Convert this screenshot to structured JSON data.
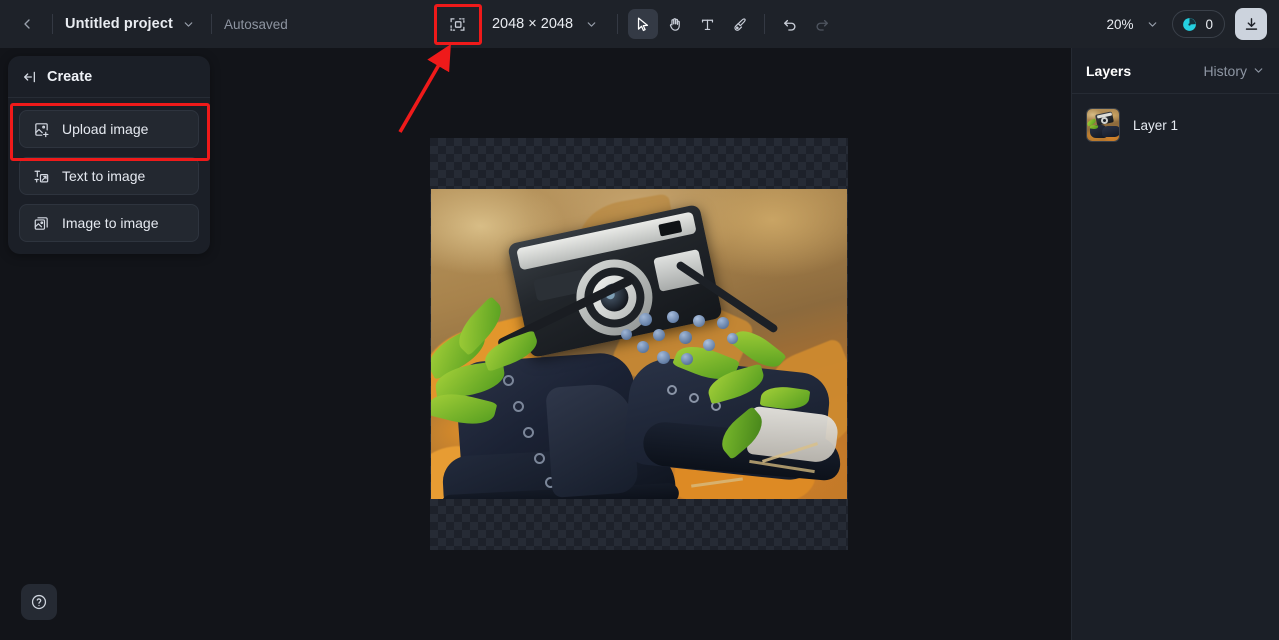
{
  "app": {
    "background_color": "#121419",
    "topbar_color": "#1e2229",
    "panel_color": "#1b1f27",
    "accent_color": "#ef1a1a",
    "credit_icon_color": "#25d0e0"
  },
  "topbar": {
    "back_label": "Back",
    "project_title": "Untitled project",
    "project_menu_icon": "chevron-down-icon",
    "autosave_status": "Autosaved",
    "resize_tool_icon": "crop-resize-icon",
    "canvas_size": "2048 × 2048",
    "canvas_size_menu_icon": "chevron-down-icon",
    "tools": [
      {
        "name": "select-tool",
        "icon": "cursor-arrow-icon",
        "active": true,
        "disabled": false
      },
      {
        "name": "hand-tool",
        "icon": "hand-icon",
        "active": false,
        "disabled": false
      },
      {
        "name": "text-tool",
        "icon": "text-t-icon",
        "active": false,
        "disabled": false
      },
      {
        "name": "brush-tool",
        "icon": "paintbrush-icon",
        "active": false,
        "disabled": false
      },
      {
        "name": "undo-button",
        "icon": "undo-arrow-icon",
        "active": false,
        "disabled": false
      },
      {
        "name": "redo-button",
        "icon": "redo-arrow-icon",
        "active": false,
        "disabled": true
      }
    ],
    "zoom_level": "20%",
    "zoom_menu_icon": "chevron-down-icon",
    "credits_count": "0",
    "credits_icon": "credit-coin-icon",
    "download_icon": "download-icon"
  },
  "create_panel": {
    "collapse_icon": "collapse-left-icon",
    "title": "Create",
    "items": [
      {
        "label": "Upload image",
        "icon": "image-plus-icon",
        "highlighted": true
      },
      {
        "label": "Text to image",
        "icon": "text-to-image-icon",
        "highlighted": false
      },
      {
        "label": "Image to image",
        "icon": "image-stack-icon",
        "highlighted": false
      }
    ]
  },
  "layers_panel": {
    "tab_layers": "Layers",
    "tab_history": "History",
    "history_chevron_icon": "chevron-down-icon",
    "layers": [
      {
        "name": "Layer 1",
        "thumbnail": "boots-camera-autumn-leaves"
      }
    ]
  },
  "canvas": {
    "artboard_label": "2048 × 2048 artboard",
    "transparency_pattern": "checkerboard",
    "image_description": "Vintage film camera resting on dark navy leather boots among autumn leaves, green foliage and blue berries"
  },
  "annotations": {
    "highlight_resize_tool": "red-rectangle-highlight",
    "highlight_upload_image": "red-rectangle-highlight",
    "arrow": "red-arrow-pointing-to-resize-tool"
  },
  "footer": {
    "help_icon": "question-mark-circle-icon",
    "help_label": "Help"
  }
}
